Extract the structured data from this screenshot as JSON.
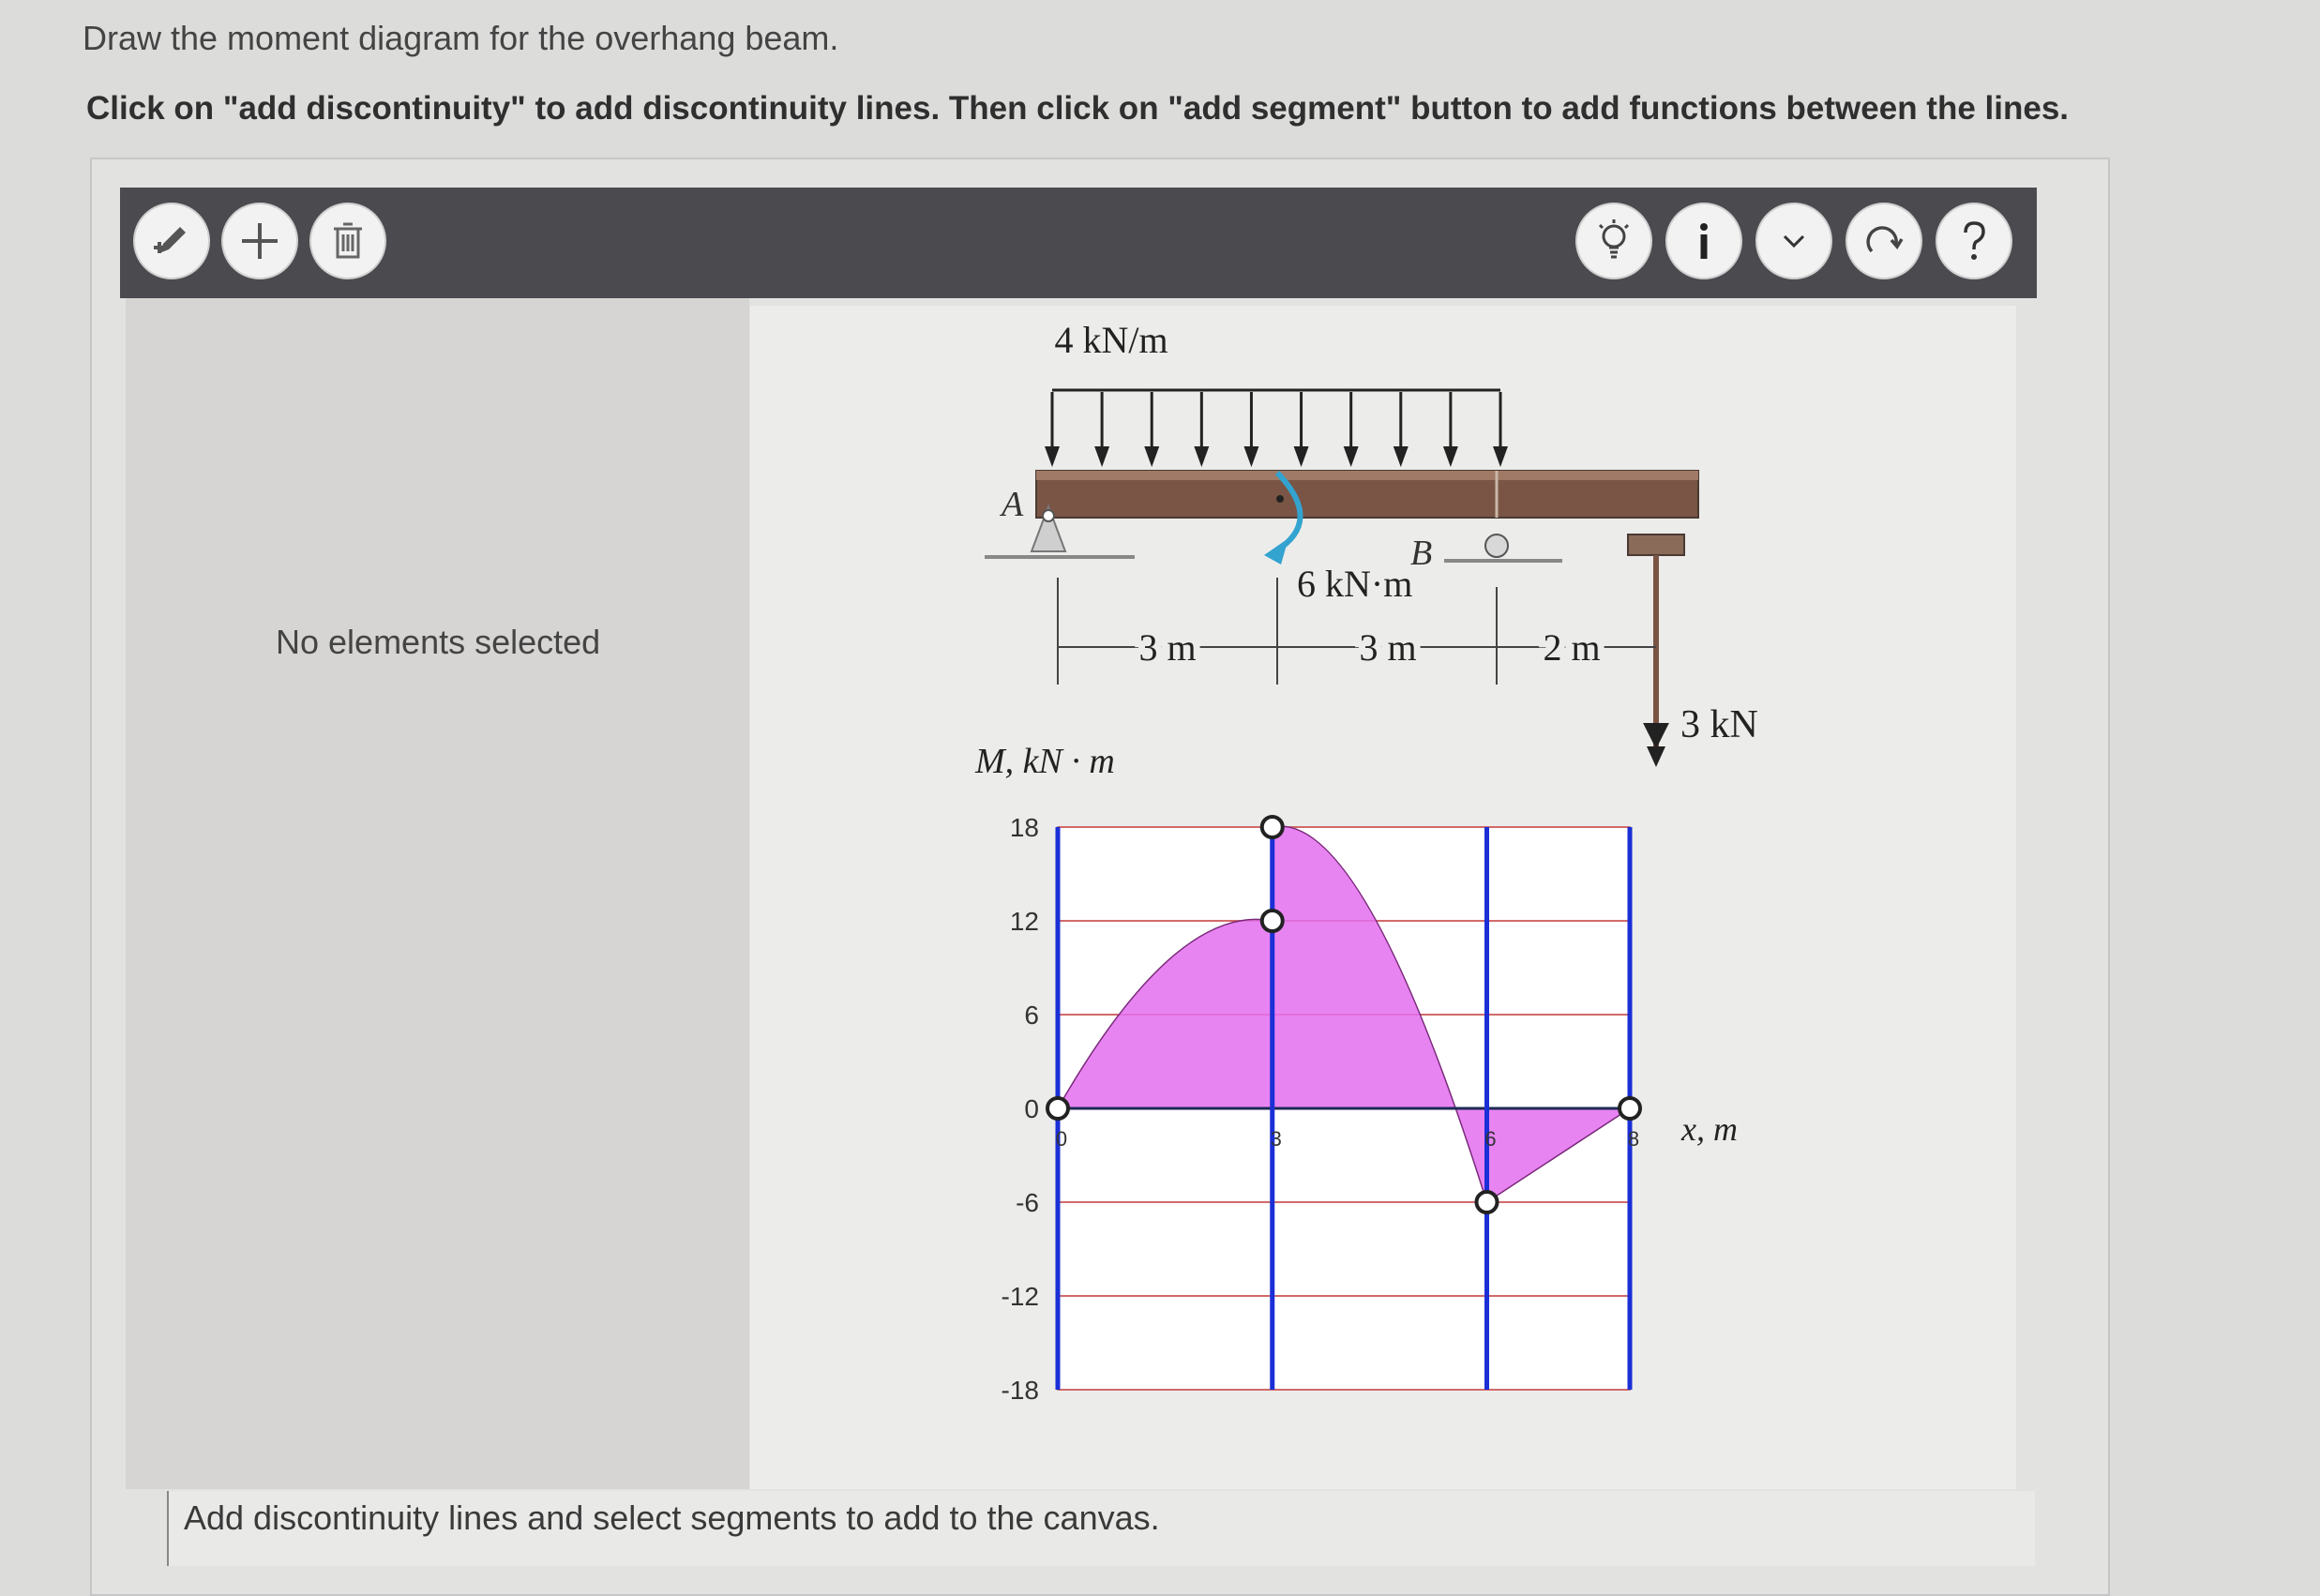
{
  "prompt": "Draw the moment diagram for the overhang beam.",
  "instructions": "Click on \"add discontinuity\" to add discontinuity lines. Then click on \"add segment\" button to add functions between the lines.",
  "toolbar": {
    "left_buttons": [
      {
        "name": "add-discontinuity-button",
        "icon": "pencil-plus-icon"
      },
      {
        "name": "add-segment-button",
        "icon": "plus-icon"
      },
      {
        "name": "delete-button",
        "icon": "trash-icon"
      }
    ],
    "right_buttons": [
      {
        "name": "hint-button",
        "icon": "lightbulb-icon"
      },
      {
        "name": "info-button",
        "icon": "info-icon"
      },
      {
        "name": "dropdown-button",
        "icon": "chevron-down-icon"
      },
      {
        "name": "reset-button",
        "icon": "redo-icon"
      },
      {
        "name": "help-button",
        "icon": "question-icon"
      }
    ]
  },
  "side_panel": {
    "text": "No elements selected"
  },
  "status": {
    "text": "Add discontinuity lines and select segments to add to the canvas."
  },
  "beam_figure": {
    "load_label": "4 kN/m",
    "support_a": "A",
    "support_b": "B",
    "couple_label": "6 kN·m",
    "dims": [
      "3 m",
      "3 m",
      "2 m"
    ],
    "point_load": "3 kN"
  },
  "chart_data": {
    "type": "area",
    "ylabel": "M, kN · m",
    "xlabel": "x, m",
    "ylim": [
      -18,
      18
    ],
    "yticks": [
      18,
      12,
      6,
      0,
      -6,
      -12,
      -18
    ],
    "xticks": [
      "0",
      "3",
      "6",
      "8"
    ],
    "discontinuity_lines_x": [
      0,
      3,
      6,
      8
    ],
    "segments": [
      {
        "x": [
          0,
          3
        ],
        "y": [
          0,
          12
        ],
        "shape": "concave"
      },
      {
        "x": [
          3,
          6
        ],
        "y": [
          18,
          -6
        ],
        "shape": "concave"
      },
      {
        "x": [
          6,
          8
        ],
        "y": [
          -6,
          0
        ],
        "shape": "linear"
      }
    ],
    "points": [
      {
        "x": 0,
        "y": 0
      },
      {
        "x": 3,
        "y": 12
      },
      {
        "x": 3,
        "y": 18
      },
      {
        "x": 6,
        "y": -6
      },
      {
        "x": 8,
        "y": 0
      }
    ],
    "fill_color": "#e46ef0",
    "line_color": "#1a2fd6",
    "grid_color": "#d26a6a"
  }
}
